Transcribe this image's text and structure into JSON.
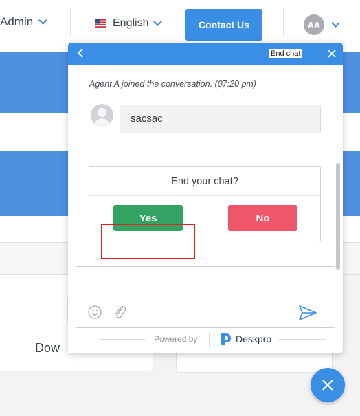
{
  "topbar": {
    "admin_label": "Admin",
    "language_label": "English",
    "contact_label": "Contact Us",
    "avatar_initials": "AA"
  },
  "background": {
    "card_label": "Dow"
  },
  "chat": {
    "end_chat_label": "End chat",
    "system_message": "Agent A joined the conversation. (07:20 pm)",
    "user_message": "sacsac",
    "confirm_title": "End your chat?",
    "yes_label": "Yes",
    "no_label": "No",
    "composer_value": "",
    "powered_by": "Powered by",
    "brand_name": "Deskpro"
  },
  "colors": {
    "accent": "#3a8ee6",
    "yes": "#35a364",
    "no": "#f0566a",
    "highlight": "#e02020"
  },
  "icons": {
    "back": "chevron-left-icon",
    "close": "close-icon",
    "emoji": "smiley-icon",
    "attach": "paperclip-icon",
    "send": "send-icon",
    "fab": "close-icon"
  }
}
